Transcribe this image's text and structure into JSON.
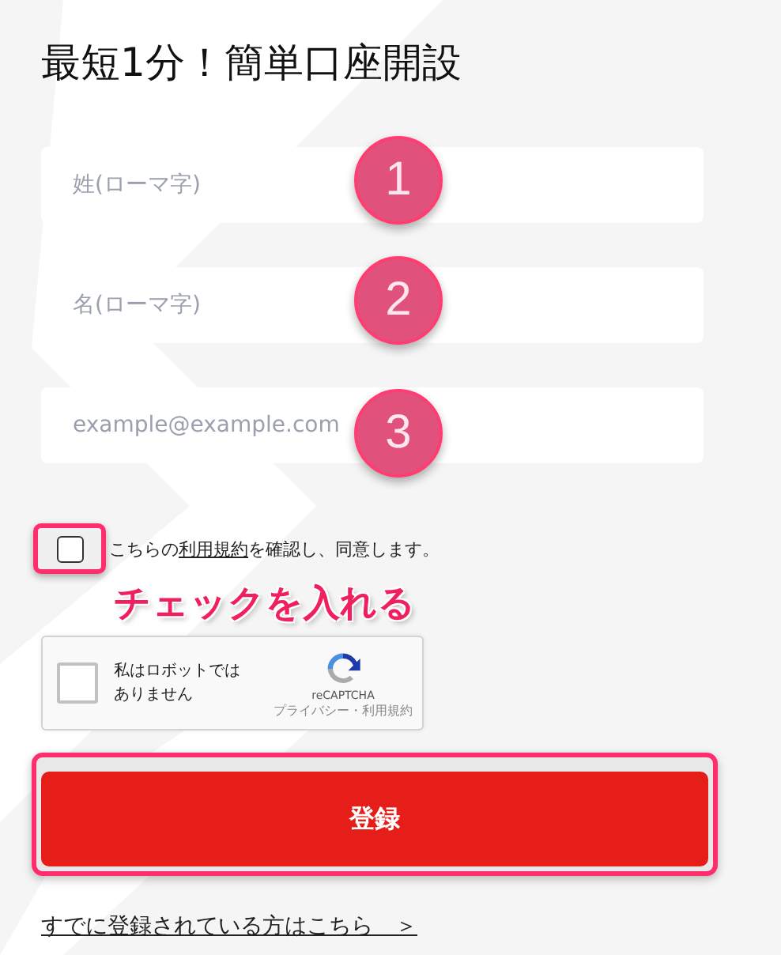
{
  "title": "最短1分！簡単口座開設",
  "fields": [
    {
      "placeholder": "姓(ローマ字)",
      "step": "1"
    },
    {
      "placeholder": "名(ローマ字)",
      "step": "2"
    },
    {
      "placeholder": "example@example.com",
      "step": "3"
    }
  ],
  "consent": {
    "before": "こちらの",
    "link": "利用規約",
    "after": "を確認し、同意します。",
    "checked": false,
    "highlighted": true
  },
  "annotation": "チェックを入れる",
  "captcha": {
    "label": "私はロボットではありません",
    "checked": false,
    "brand": "reCAPTCHA",
    "links": "プライバシー・利用規約"
  },
  "submit": {
    "label": "登録",
    "highlighted": true
  },
  "login_link": "すでに登録されている方はこちら　＞"
}
